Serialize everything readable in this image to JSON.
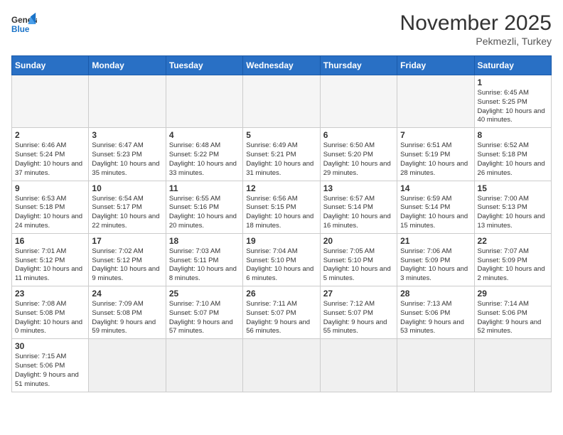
{
  "header": {
    "logo_general": "General",
    "logo_blue": "Blue",
    "month_title": "November 2025",
    "location": "Pekmezli, Turkey"
  },
  "days_of_week": [
    "Sunday",
    "Monday",
    "Tuesday",
    "Wednesday",
    "Thursday",
    "Friday",
    "Saturday"
  ],
  "weeks": [
    [
      {
        "day": "",
        "info": "",
        "empty": true
      },
      {
        "day": "",
        "info": "",
        "empty": true
      },
      {
        "day": "",
        "info": "",
        "empty": true
      },
      {
        "day": "",
        "info": "",
        "empty": true
      },
      {
        "day": "",
        "info": "",
        "empty": true
      },
      {
        "day": "",
        "info": "",
        "empty": true
      },
      {
        "day": "1",
        "info": "Sunrise: 6:45 AM\nSunset: 5:25 PM\nDaylight: 10 hours\nand 40 minutes."
      }
    ],
    [
      {
        "day": "2",
        "info": "Sunrise: 6:46 AM\nSunset: 5:24 PM\nDaylight: 10 hours\nand 37 minutes."
      },
      {
        "day": "3",
        "info": "Sunrise: 6:47 AM\nSunset: 5:23 PM\nDaylight: 10 hours\nand 35 minutes."
      },
      {
        "day": "4",
        "info": "Sunrise: 6:48 AM\nSunset: 5:22 PM\nDaylight: 10 hours\nand 33 minutes."
      },
      {
        "day": "5",
        "info": "Sunrise: 6:49 AM\nSunset: 5:21 PM\nDaylight: 10 hours\nand 31 minutes."
      },
      {
        "day": "6",
        "info": "Sunrise: 6:50 AM\nSunset: 5:20 PM\nDaylight: 10 hours\nand 29 minutes."
      },
      {
        "day": "7",
        "info": "Sunrise: 6:51 AM\nSunset: 5:19 PM\nDaylight: 10 hours\nand 28 minutes."
      },
      {
        "day": "8",
        "info": "Sunrise: 6:52 AM\nSunset: 5:18 PM\nDaylight: 10 hours\nand 26 minutes."
      }
    ],
    [
      {
        "day": "9",
        "info": "Sunrise: 6:53 AM\nSunset: 5:18 PM\nDaylight: 10 hours\nand 24 minutes."
      },
      {
        "day": "10",
        "info": "Sunrise: 6:54 AM\nSunset: 5:17 PM\nDaylight: 10 hours\nand 22 minutes."
      },
      {
        "day": "11",
        "info": "Sunrise: 6:55 AM\nSunset: 5:16 PM\nDaylight: 10 hours\nand 20 minutes."
      },
      {
        "day": "12",
        "info": "Sunrise: 6:56 AM\nSunset: 5:15 PM\nDaylight: 10 hours\nand 18 minutes."
      },
      {
        "day": "13",
        "info": "Sunrise: 6:57 AM\nSunset: 5:14 PM\nDaylight: 10 hours\nand 16 minutes."
      },
      {
        "day": "14",
        "info": "Sunrise: 6:59 AM\nSunset: 5:14 PM\nDaylight: 10 hours\nand 15 minutes."
      },
      {
        "day": "15",
        "info": "Sunrise: 7:00 AM\nSunset: 5:13 PM\nDaylight: 10 hours\nand 13 minutes."
      }
    ],
    [
      {
        "day": "16",
        "info": "Sunrise: 7:01 AM\nSunset: 5:12 PM\nDaylight: 10 hours\nand 11 minutes."
      },
      {
        "day": "17",
        "info": "Sunrise: 7:02 AM\nSunset: 5:12 PM\nDaylight: 10 hours\nand 9 minutes."
      },
      {
        "day": "18",
        "info": "Sunrise: 7:03 AM\nSunset: 5:11 PM\nDaylight: 10 hours\nand 8 minutes."
      },
      {
        "day": "19",
        "info": "Sunrise: 7:04 AM\nSunset: 5:10 PM\nDaylight: 10 hours\nand 6 minutes."
      },
      {
        "day": "20",
        "info": "Sunrise: 7:05 AM\nSunset: 5:10 PM\nDaylight: 10 hours\nand 5 minutes."
      },
      {
        "day": "21",
        "info": "Sunrise: 7:06 AM\nSunset: 5:09 PM\nDaylight: 10 hours\nand 3 minutes."
      },
      {
        "day": "22",
        "info": "Sunrise: 7:07 AM\nSunset: 5:09 PM\nDaylight: 10 hours\nand 2 minutes."
      }
    ],
    [
      {
        "day": "23",
        "info": "Sunrise: 7:08 AM\nSunset: 5:08 PM\nDaylight: 10 hours\nand 0 minutes."
      },
      {
        "day": "24",
        "info": "Sunrise: 7:09 AM\nSunset: 5:08 PM\nDaylight: 9 hours\nand 59 minutes."
      },
      {
        "day": "25",
        "info": "Sunrise: 7:10 AM\nSunset: 5:07 PM\nDaylight: 9 hours\nand 57 minutes."
      },
      {
        "day": "26",
        "info": "Sunrise: 7:11 AM\nSunset: 5:07 PM\nDaylight: 9 hours\nand 56 minutes."
      },
      {
        "day": "27",
        "info": "Sunrise: 7:12 AM\nSunset: 5:07 PM\nDaylight: 9 hours\nand 55 minutes."
      },
      {
        "day": "28",
        "info": "Sunrise: 7:13 AM\nSunset: 5:06 PM\nDaylight: 9 hours\nand 53 minutes."
      },
      {
        "day": "29",
        "info": "Sunrise: 7:14 AM\nSunset: 5:06 PM\nDaylight: 9 hours\nand 52 minutes."
      }
    ],
    [
      {
        "day": "30",
        "info": "Sunrise: 7:15 AM\nSunset: 5:06 PM\nDaylight: 9 hours\nand 51 minutes."
      },
      {
        "day": "",
        "info": "",
        "empty": true
      },
      {
        "day": "",
        "info": "",
        "empty": true
      },
      {
        "day": "",
        "info": "",
        "empty": true
      },
      {
        "day": "",
        "info": "",
        "empty": true
      },
      {
        "day": "",
        "info": "",
        "empty": true
      },
      {
        "day": "",
        "info": "",
        "empty": true
      }
    ]
  ]
}
